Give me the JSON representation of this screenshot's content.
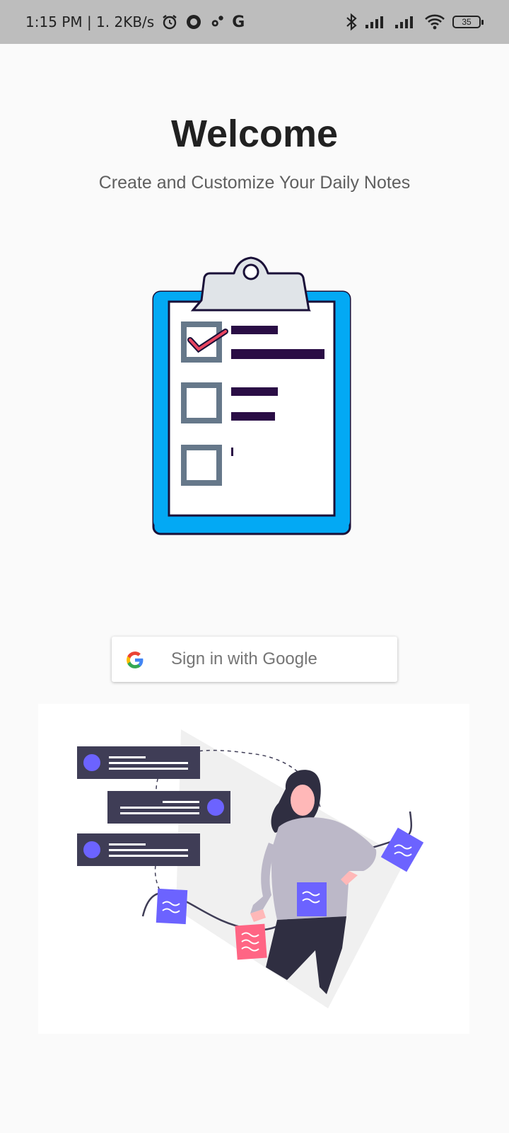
{
  "status_bar": {
    "time_and_speed": "1:15 PM | 1. 2KB/s",
    "google_glyph": "G",
    "battery": "35",
    "icons": [
      "alarm-icon",
      "circle-app-icon",
      "settings-icon",
      "google-icon",
      "bluetooth-icon",
      "signal-icon",
      "signal-icon",
      "wifi-icon",
      "battery-icon"
    ]
  },
  "welcome": {
    "title": "Welcome",
    "subtitle": "Create and Customize Your Daily Notes"
  },
  "signin": {
    "label": "Sign in with Google"
  },
  "colors": {
    "background": "#fafafa",
    "clipboard_blue": "#03a9f4",
    "accent_purple": "#6c63ff",
    "accent_pink": "#ff6584",
    "dark": "#2f2e41"
  }
}
